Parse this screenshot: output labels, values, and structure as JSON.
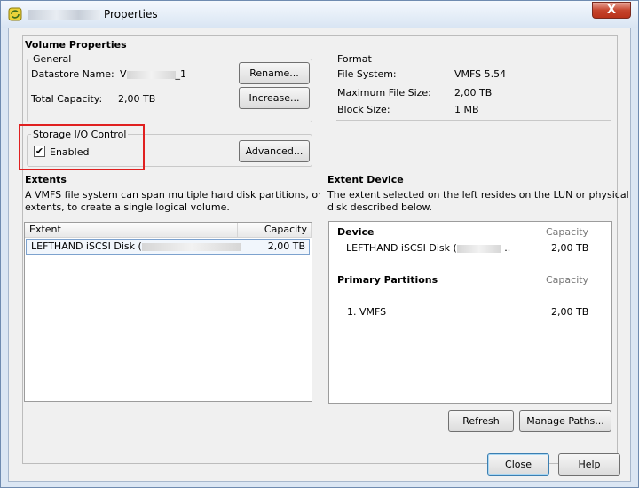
{
  "window": {
    "title": "Properties",
    "close_glyph": "X"
  },
  "volume_properties": {
    "heading": "Volume Properties",
    "general": {
      "legend": "General",
      "datastore_label": "Datastore Name:",
      "datastore_prefix": "V",
      "datastore_suffix": "_1",
      "capacity_label": "Total Capacity:",
      "capacity_value": "2,00 TB",
      "rename_button": "Rename...",
      "increase_button": "Increase..."
    },
    "format": {
      "heading": "Format",
      "file_system_label": "File System:",
      "file_system_value": "VMFS 5.54",
      "max_file_label": "Maximum File Size:",
      "max_file_value": "2,00 TB",
      "block_size_label": "Block Size:",
      "block_size_value": "1 MB"
    }
  },
  "sioc": {
    "legend": "Storage I/O Control",
    "enabled_label": "Enabled",
    "enabled_checked": true,
    "check_glyph": "✔",
    "advanced_button": "Advanced..."
  },
  "extents": {
    "heading": "Extents",
    "description_1": "A VMFS file system can span multiple hard disk partitions, or",
    "description_2": "extents, to create a single logical volume.",
    "columns": [
      "Extent",
      "Capacity"
    ],
    "rows": [
      {
        "extent": "LEFTHAND iSCSI Disk (",
        "capacity": "2,00 TB"
      }
    ]
  },
  "extent_device": {
    "heading": "Extent Device",
    "description_1": "The extent selected on the left resides on the LUN or physical",
    "description_2": "disk described below.",
    "device_heading": "Device",
    "device_capacity_heading": "Capacity",
    "device_name": "LEFTHAND iSCSI Disk (",
    "device_name_suffix": "..",
    "device_capacity": "2,00 TB",
    "partitions_heading": "Primary Partitions",
    "partitions_capacity_heading": "Capacity",
    "partition_name": "1. VMFS",
    "partition_capacity": "2,00 TB",
    "refresh_button": "Refresh",
    "manage_paths_button": "Manage Paths..."
  },
  "footer": {
    "close_button": "Close",
    "help_button": "Help"
  }
}
